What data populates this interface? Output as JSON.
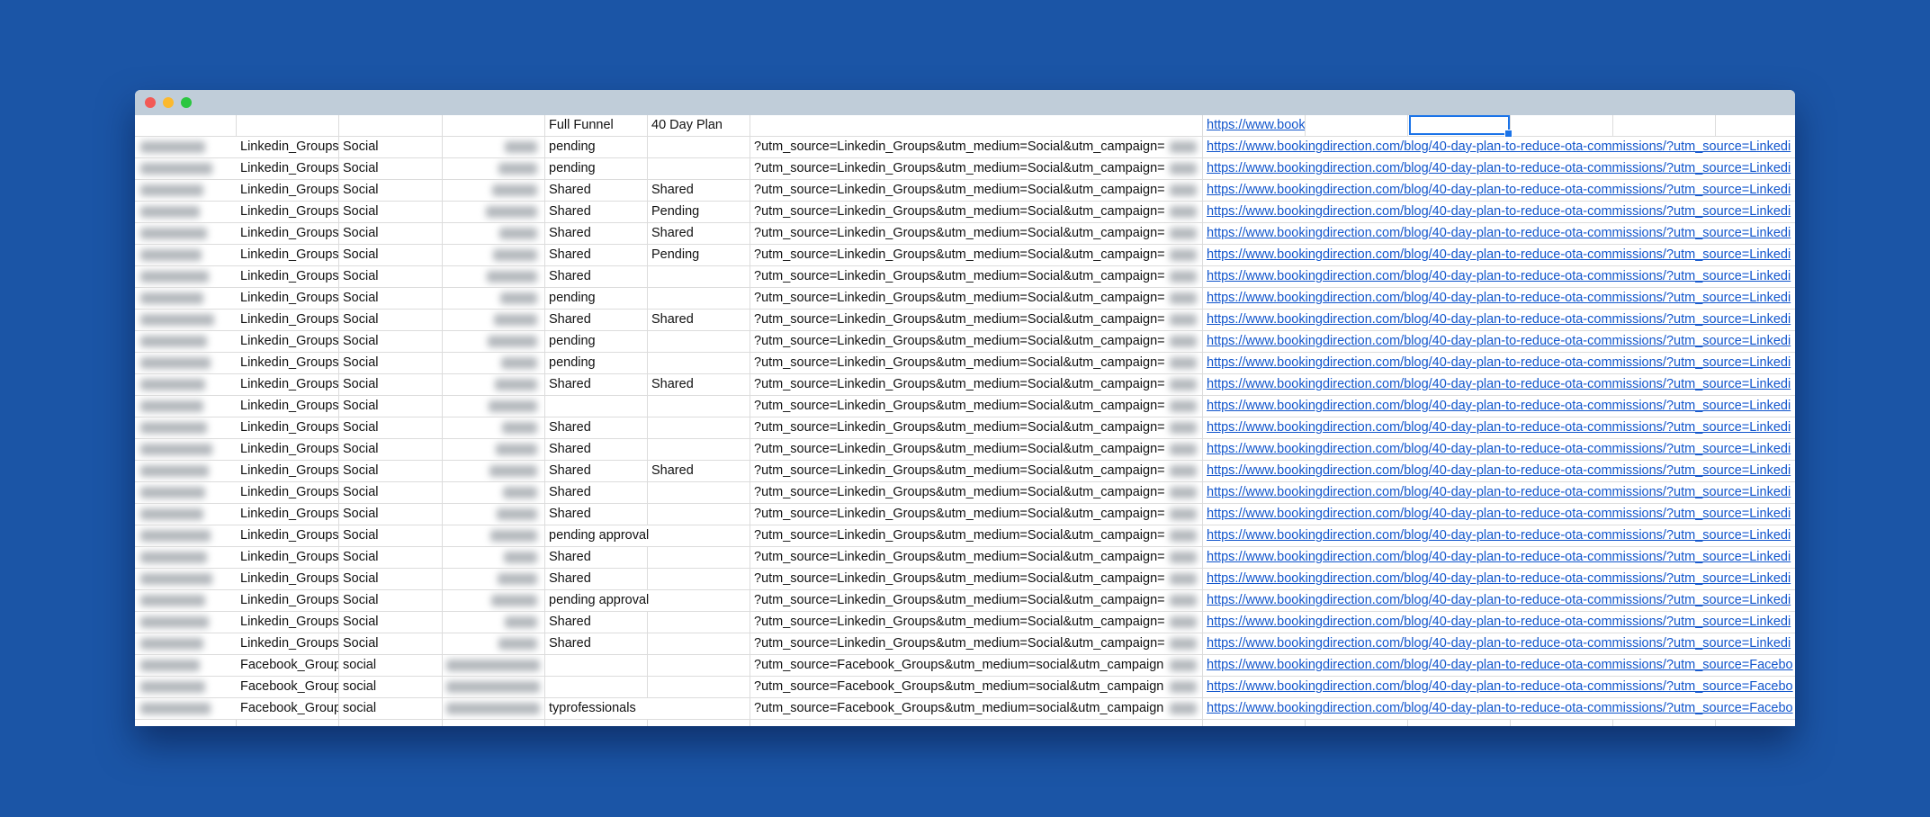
{
  "window": {
    "controls": [
      "close",
      "minimize",
      "maximize"
    ],
    "colors": {
      "background": "#1b55a6",
      "titlebar": "#c0cdd9",
      "link": "#1155cc",
      "selection": "#1a73e8"
    }
  },
  "header_row": {
    "full_funnel": "Full Funnel",
    "day_plan": "40 Day Plan",
    "link": "https://www.book"
  },
  "rows": [
    {
      "source": "Linkedin_Groups",
      "medium": "Social",
      "full_funnel": "pending",
      "day_plan": "",
      "utm": "?utm_source=Linkedin_Groups&utm_medium=Social&utm_campaign=",
      "link": "https://www.bookingdirection.com/blog/40-day-plan-to-reduce-ota-commissions/?utm_source=Linkedi"
    },
    {
      "source": "Linkedin_Groups",
      "medium": "Social",
      "full_funnel": "pending",
      "day_plan": "",
      "utm": "?utm_source=Linkedin_Groups&utm_medium=Social&utm_campaign=",
      "link": "https://www.bookingdirection.com/blog/40-day-plan-to-reduce-ota-commissions/?utm_source=Linkedi"
    },
    {
      "source": "Linkedin_Groups",
      "medium": "Social",
      "full_funnel": "Shared",
      "day_plan": "Shared",
      "utm": "?utm_source=Linkedin_Groups&utm_medium=Social&utm_campaign=",
      "link": "https://www.bookingdirection.com/blog/40-day-plan-to-reduce-ota-commissions/?utm_source=Linkedi"
    },
    {
      "source": "Linkedin_Groups",
      "medium": "Social",
      "full_funnel": "Shared",
      "day_plan": "Pending",
      "utm": "?utm_source=Linkedin_Groups&utm_medium=Social&utm_campaign=",
      "link": "https://www.bookingdirection.com/blog/40-day-plan-to-reduce-ota-commissions/?utm_source=Linkedi"
    },
    {
      "source": "Linkedin_Groups",
      "medium": "Social",
      "full_funnel": "Shared",
      "day_plan": "Shared",
      "utm": "?utm_source=Linkedin_Groups&utm_medium=Social&utm_campaign=",
      "link": "https://www.bookingdirection.com/blog/40-day-plan-to-reduce-ota-commissions/?utm_source=Linkedi"
    },
    {
      "source": "Linkedin_Groups",
      "medium": "Social",
      "full_funnel": "Shared",
      "day_plan": "Pending",
      "utm": "?utm_source=Linkedin_Groups&utm_medium=Social&utm_campaign=",
      "link": "https://www.bookingdirection.com/blog/40-day-plan-to-reduce-ota-commissions/?utm_source=Linkedi"
    },
    {
      "source": "Linkedin_Groups",
      "medium": "Social",
      "full_funnel": "Shared",
      "day_plan": "",
      "utm": "?utm_source=Linkedin_Groups&utm_medium=Social&utm_campaign=",
      "link": "https://www.bookingdirection.com/blog/40-day-plan-to-reduce-ota-commissions/?utm_source=Linkedi"
    },
    {
      "source": "Linkedin_Groups",
      "medium": "Social",
      "full_funnel": "pending",
      "day_plan": "",
      "utm": "?utm_source=Linkedin_Groups&utm_medium=Social&utm_campaign=",
      "link": "https://www.bookingdirection.com/blog/40-day-plan-to-reduce-ota-commissions/?utm_source=Linkedi"
    },
    {
      "source": "Linkedin_Groups",
      "medium": "Social",
      "full_funnel": "Shared",
      "day_plan": "Shared",
      "utm": "?utm_source=Linkedin_Groups&utm_medium=Social&utm_campaign=",
      "link": "https://www.bookingdirection.com/blog/40-day-plan-to-reduce-ota-commissions/?utm_source=Linkedi"
    },
    {
      "source": "Linkedin_Groups",
      "medium": "Social",
      "full_funnel": "pending",
      "day_plan": "",
      "utm": "?utm_source=Linkedin_Groups&utm_medium=Social&utm_campaign=",
      "link": "https://www.bookingdirection.com/blog/40-day-plan-to-reduce-ota-commissions/?utm_source=Linkedi"
    },
    {
      "source": "Linkedin_Groups",
      "medium": "Social",
      "full_funnel": "pending",
      "day_plan": "",
      "utm": "?utm_source=Linkedin_Groups&utm_medium=Social&utm_campaign=",
      "link": "https://www.bookingdirection.com/blog/40-day-plan-to-reduce-ota-commissions/?utm_source=Linkedi"
    },
    {
      "source": "Linkedin_Groups",
      "medium": "Social",
      "full_funnel": "Shared",
      "day_plan": "Shared",
      "utm": "?utm_source=Linkedin_Groups&utm_medium=Social&utm_campaign=",
      "link": "https://www.bookingdirection.com/blog/40-day-plan-to-reduce-ota-commissions/?utm_source=Linkedi"
    },
    {
      "source": "Linkedin_Groups",
      "medium": "Social",
      "full_funnel": "",
      "day_plan": "",
      "utm": "?utm_source=Linkedin_Groups&utm_medium=Social&utm_campaign=",
      "link": "https://www.bookingdirection.com/blog/40-day-plan-to-reduce-ota-commissions/?utm_source=Linkedi"
    },
    {
      "source": "Linkedin_Groups",
      "medium": "Social",
      "full_funnel": "Shared",
      "day_plan": "",
      "utm": "?utm_source=Linkedin_Groups&utm_medium=Social&utm_campaign=",
      "link": "https://www.bookingdirection.com/blog/40-day-plan-to-reduce-ota-commissions/?utm_source=Linkedi"
    },
    {
      "source": "Linkedin_Groups",
      "medium": "Social",
      "full_funnel": "Shared",
      "day_plan": "",
      "utm": "?utm_source=Linkedin_Groups&utm_medium=Social&utm_campaign=",
      "link": "https://www.bookingdirection.com/blog/40-day-plan-to-reduce-ota-commissions/?utm_source=Linkedi"
    },
    {
      "source": "Linkedin_Groups",
      "medium": "Social",
      "full_funnel": "Shared",
      "day_plan": "Shared",
      "utm": "?utm_source=Linkedin_Groups&utm_medium=Social&utm_campaign=",
      "link": "https://www.bookingdirection.com/blog/40-day-plan-to-reduce-ota-commissions/?utm_source=Linkedi"
    },
    {
      "source": "Linkedin_Groups",
      "medium": "Social",
      "full_funnel": "Shared",
      "day_plan": "",
      "utm": "?utm_source=Linkedin_Groups&utm_medium=Social&utm_campaign=",
      "link": "https://www.bookingdirection.com/blog/40-day-plan-to-reduce-ota-commissions/?utm_source=Linkedi"
    },
    {
      "source": "Linkedin_Groups",
      "medium": "Social",
      "full_funnel": "Shared",
      "day_plan": "",
      "utm": "?utm_source=Linkedin_Groups&utm_medium=Social&utm_campaign=",
      "link": "https://www.bookingdirection.com/blog/40-day-plan-to-reduce-ota-commissions/?utm_source=Linkedi"
    },
    {
      "source": "Linkedin_Groups",
      "medium": "Social",
      "full_funnel": "pending approval",
      "day_plan": "",
      "utm": "?utm_source=Linkedin_Groups&utm_medium=Social&utm_campaign=",
      "link": "https://www.bookingdirection.com/blog/40-day-plan-to-reduce-ota-commissions/?utm_source=Linkedi"
    },
    {
      "source": "Linkedin_Groups",
      "medium": "Social",
      "full_funnel": "Shared",
      "day_plan": "",
      "utm": "?utm_source=Linkedin_Groups&utm_medium=Social&utm_campaign=",
      "link": "https://www.bookingdirection.com/blog/40-day-plan-to-reduce-ota-commissions/?utm_source=Linkedi"
    },
    {
      "source": "Linkedin_Groups",
      "medium": "Social",
      "full_funnel": "Shared",
      "day_plan": "",
      "utm": "?utm_source=Linkedin_Groups&utm_medium=Social&utm_campaign=",
      "link": "https://www.bookingdirection.com/blog/40-day-plan-to-reduce-ota-commissions/?utm_source=Linkedi"
    },
    {
      "source": "Linkedin_Groups",
      "medium": "Social",
      "full_funnel": "pending approval",
      "day_plan": "",
      "utm": "?utm_source=Linkedin_Groups&utm_medium=Social&utm_campaign=",
      "link": "https://www.bookingdirection.com/blog/40-day-plan-to-reduce-ota-commissions/?utm_source=Linkedi"
    },
    {
      "source": "Linkedin_Groups",
      "medium": "Social",
      "full_funnel": "Shared",
      "day_plan": "",
      "utm": "?utm_source=Linkedin_Groups&utm_medium=Social&utm_campaign=",
      "link": "https://www.bookingdirection.com/blog/40-day-plan-to-reduce-ota-commissions/?utm_source=Linkedi"
    },
    {
      "source": "Linkedin_Groups",
      "medium": "Social",
      "full_funnel": "Shared",
      "day_plan": "",
      "utm": "?utm_source=Linkedin_Groups&utm_medium=Social&utm_campaign=",
      "link": "https://www.bookingdirection.com/blog/40-day-plan-to-reduce-ota-commissions/?utm_source=Linkedi"
    },
    {
      "source": "Facebook_Group",
      "medium": "social",
      "full_funnel": "",
      "day_plan": "",
      "utm": "?utm_source=Facebook_Groups&utm_medium=social&utm_campaign",
      "link": "https://www.bookingdirection.com/blog/40-day-plan-to-reduce-ota-commissions/?utm_source=Facebo"
    },
    {
      "source": "Facebook_Group",
      "medium": "social",
      "full_funnel": "",
      "day_plan": "",
      "utm": "?utm_source=Facebook_Groups&utm_medium=social&utm_campaign",
      "link": "https://www.bookingdirection.com/blog/40-day-plan-to-reduce-ota-commissions/?utm_source=Facebo"
    },
    {
      "source": "Facebook_Group",
      "medium": "social",
      "full_funnel": "typrofessionals",
      "day_plan": "",
      "utm": "?utm_source=Facebook_Groups&utm_medium=social&utm_campaign",
      "link": "https://www.bookingdirection.com/blog/40-day-plan-to-reduce-ota-commissions/?utm_source=Facebo"
    }
  ]
}
